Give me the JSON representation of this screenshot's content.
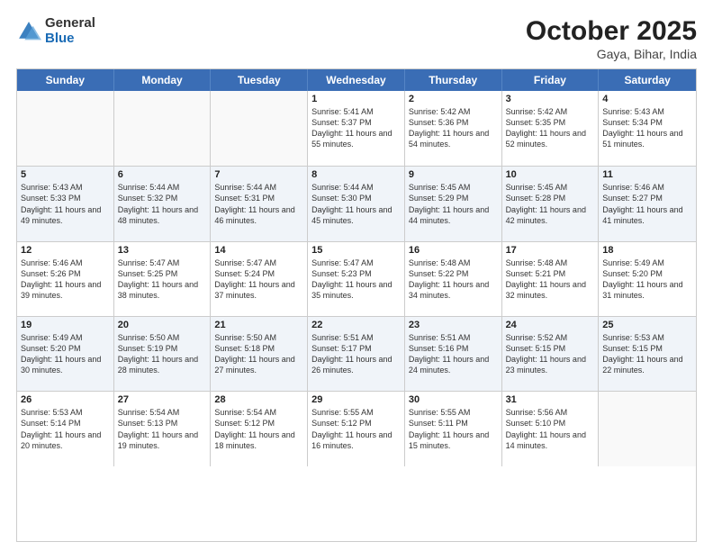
{
  "logo": {
    "general": "General",
    "blue": "Blue"
  },
  "header": {
    "month": "October 2025",
    "location": "Gaya, Bihar, India"
  },
  "weekdays": [
    "Sunday",
    "Monday",
    "Tuesday",
    "Wednesday",
    "Thursday",
    "Friday",
    "Saturday"
  ],
  "weeks": [
    [
      {
        "day": "",
        "info": ""
      },
      {
        "day": "",
        "info": ""
      },
      {
        "day": "",
        "info": ""
      },
      {
        "day": "1",
        "info": "Sunrise: 5:41 AM\nSunset: 5:37 PM\nDaylight: 11 hours and 55 minutes."
      },
      {
        "day": "2",
        "info": "Sunrise: 5:42 AM\nSunset: 5:36 PM\nDaylight: 11 hours and 54 minutes."
      },
      {
        "day": "3",
        "info": "Sunrise: 5:42 AM\nSunset: 5:35 PM\nDaylight: 11 hours and 52 minutes."
      },
      {
        "day": "4",
        "info": "Sunrise: 5:43 AM\nSunset: 5:34 PM\nDaylight: 11 hours and 51 minutes."
      }
    ],
    [
      {
        "day": "5",
        "info": "Sunrise: 5:43 AM\nSunset: 5:33 PM\nDaylight: 11 hours and 49 minutes."
      },
      {
        "day": "6",
        "info": "Sunrise: 5:44 AM\nSunset: 5:32 PM\nDaylight: 11 hours and 48 minutes."
      },
      {
        "day": "7",
        "info": "Sunrise: 5:44 AM\nSunset: 5:31 PM\nDaylight: 11 hours and 46 minutes."
      },
      {
        "day": "8",
        "info": "Sunrise: 5:44 AM\nSunset: 5:30 PM\nDaylight: 11 hours and 45 minutes."
      },
      {
        "day": "9",
        "info": "Sunrise: 5:45 AM\nSunset: 5:29 PM\nDaylight: 11 hours and 44 minutes."
      },
      {
        "day": "10",
        "info": "Sunrise: 5:45 AM\nSunset: 5:28 PM\nDaylight: 11 hours and 42 minutes."
      },
      {
        "day": "11",
        "info": "Sunrise: 5:46 AM\nSunset: 5:27 PM\nDaylight: 11 hours and 41 minutes."
      }
    ],
    [
      {
        "day": "12",
        "info": "Sunrise: 5:46 AM\nSunset: 5:26 PM\nDaylight: 11 hours and 39 minutes."
      },
      {
        "day": "13",
        "info": "Sunrise: 5:47 AM\nSunset: 5:25 PM\nDaylight: 11 hours and 38 minutes."
      },
      {
        "day": "14",
        "info": "Sunrise: 5:47 AM\nSunset: 5:24 PM\nDaylight: 11 hours and 37 minutes."
      },
      {
        "day": "15",
        "info": "Sunrise: 5:47 AM\nSunset: 5:23 PM\nDaylight: 11 hours and 35 minutes."
      },
      {
        "day": "16",
        "info": "Sunrise: 5:48 AM\nSunset: 5:22 PM\nDaylight: 11 hours and 34 minutes."
      },
      {
        "day": "17",
        "info": "Sunrise: 5:48 AM\nSunset: 5:21 PM\nDaylight: 11 hours and 32 minutes."
      },
      {
        "day": "18",
        "info": "Sunrise: 5:49 AM\nSunset: 5:20 PM\nDaylight: 11 hours and 31 minutes."
      }
    ],
    [
      {
        "day": "19",
        "info": "Sunrise: 5:49 AM\nSunset: 5:20 PM\nDaylight: 11 hours and 30 minutes."
      },
      {
        "day": "20",
        "info": "Sunrise: 5:50 AM\nSunset: 5:19 PM\nDaylight: 11 hours and 28 minutes."
      },
      {
        "day": "21",
        "info": "Sunrise: 5:50 AM\nSunset: 5:18 PM\nDaylight: 11 hours and 27 minutes."
      },
      {
        "day": "22",
        "info": "Sunrise: 5:51 AM\nSunset: 5:17 PM\nDaylight: 11 hours and 26 minutes."
      },
      {
        "day": "23",
        "info": "Sunrise: 5:51 AM\nSunset: 5:16 PM\nDaylight: 11 hours and 24 minutes."
      },
      {
        "day": "24",
        "info": "Sunrise: 5:52 AM\nSunset: 5:15 PM\nDaylight: 11 hours and 23 minutes."
      },
      {
        "day": "25",
        "info": "Sunrise: 5:53 AM\nSunset: 5:15 PM\nDaylight: 11 hours and 22 minutes."
      }
    ],
    [
      {
        "day": "26",
        "info": "Sunrise: 5:53 AM\nSunset: 5:14 PM\nDaylight: 11 hours and 20 minutes."
      },
      {
        "day": "27",
        "info": "Sunrise: 5:54 AM\nSunset: 5:13 PM\nDaylight: 11 hours and 19 minutes."
      },
      {
        "day": "28",
        "info": "Sunrise: 5:54 AM\nSunset: 5:12 PM\nDaylight: 11 hours and 18 minutes."
      },
      {
        "day": "29",
        "info": "Sunrise: 5:55 AM\nSunset: 5:12 PM\nDaylight: 11 hours and 16 minutes."
      },
      {
        "day": "30",
        "info": "Sunrise: 5:55 AM\nSunset: 5:11 PM\nDaylight: 11 hours and 15 minutes."
      },
      {
        "day": "31",
        "info": "Sunrise: 5:56 AM\nSunset: 5:10 PM\nDaylight: 11 hours and 14 minutes."
      },
      {
        "day": "",
        "info": ""
      }
    ]
  ]
}
